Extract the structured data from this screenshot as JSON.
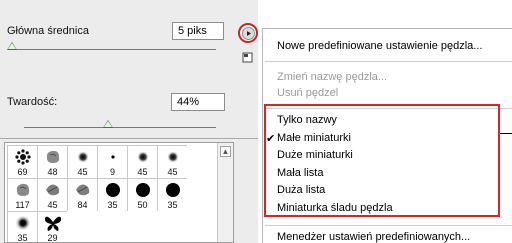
{
  "panel": {
    "diameter": {
      "label": "Główna średnica",
      "value": "5 piks"
    },
    "hardness": {
      "label": "Twardość:",
      "value": "44%",
      "slider_value_percent": 44
    },
    "diameter_slider_value_percent": 2,
    "menu_button_icon": "menu-arrow-icon",
    "new_brush_icon": "new-preset-icon",
    "brushes": [
      {
        "size": "69",
        "icon": "splat-icon"
      },
      {
        "size": "48",
        "icon": "rock-icon"
      },
      {
        "size": "45",
        "icon": "soft-dot-icon"
      },
      {
        "size": "9",
        "icon": "small-dot-icon"
      },
      {
        "size": "45",
        "icon": "soft-dot-icon"
      },
      {
        "size": "45",
        "icon": "soft-dot-icon"
      },
      {
        "size": "117",
        "icon": "rock-icon"
      },
      {
        "size": "45",
        "icon": "leaf-icon"
      },
      {
        "size": "84",
        "icon": "leaf-icon"
      },
      {
        "size": "35",
        "icon": "hard-dot-icon"
      },
      {
        "size": "50",
        "icon": "hard-dot-icon"
      },
      {
        "size": "35",
        "icon": "hard-dot-icon"
      },
      {
        "size": "35",
        "icon": "fuzzy-dot-icon"
      },
      {
        "size": "29",
        "icon": "butterfly-icon"
      }
    ]
  },
  "menu": {
    "new_preset": "Nowe predefiniowane ustawienie pędzla...",
    "rename": "Zmień nazwę pędzla...",
    "delete": "Usuń pędzel",
    "view_options": [
      {
        "label": "Tylko nazwy",
        "checked": false
      },
      {
        "label": "Małe miniaturki",
        "checked": true
      },
      {
        "label": "Duże miniaturki",
        "checked": false
      },
      {
        "label": "Mała lista",
        "checked": false
      },
      {
        "label": "Duża lista",
        "checked": false
      },
      {
        "label": "Miniaturka śladu pędzla",
        "checked": false
      }
    ],
    "preset_manager": "Menedżer ustawień predefiniowanych...",
    "highlight_color": "#d8242b"
  }
}
